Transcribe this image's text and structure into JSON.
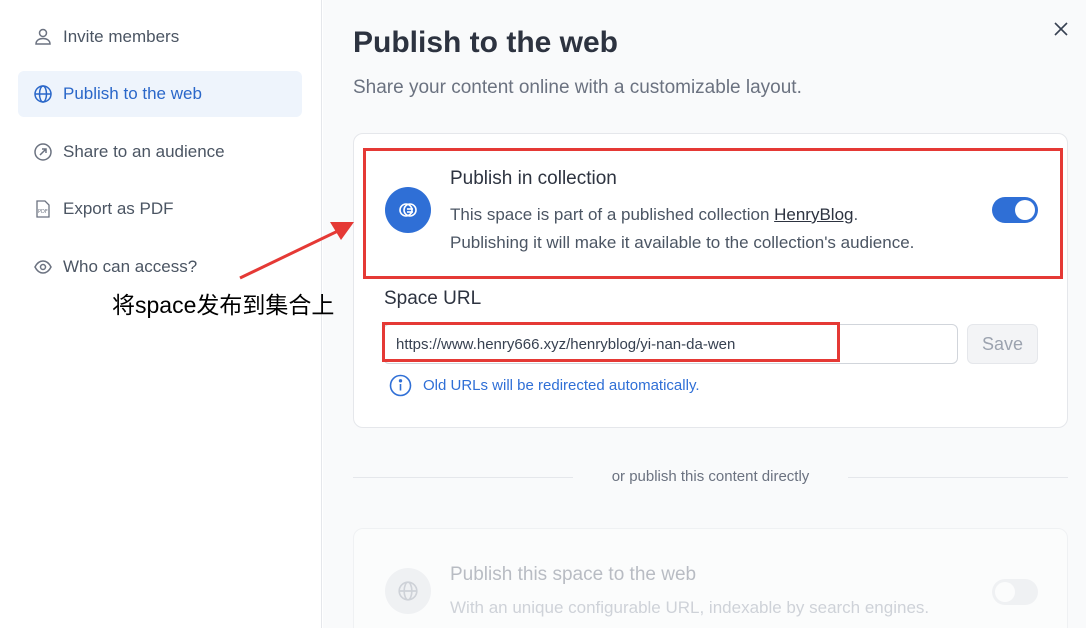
{
  "sidebar": {
    "items": [
      {
        "label": "Invite members",
        "icon": "users-icon"
      },
      {
        "label": "Publish to the web",
        "icon": "globe-icon",
        "active": true
      },
      {
        "label": "Share to an audience",
        "icon": "share-icon"
      },
      {
        "label": "Export as PDF",
        "icon": "pdf-icon"
      },
      {
        "label": "Who can access?",
        "icon": "eye-icon"
      }
    ]
  },
  "main": {
    "title": "Publish to the web",
    "subtitle": "Share your content online with a customizable layout.",
    "collection": {
      "heading": "Publish in collection",
      "desc_prefix": "This space is part of a published collection ",
      "collection_link": "HenryBlog",
      "desc_suffix": ".",
      "desc_line2": "Publishing it will make it available to the collection's audience.",
      "toggle_on": true
    },
    "space_url": {
      "label": "Space URL",
      "value": "https://www.henry666.xyz/henryblog/yi-nan-da-wen",
      "save_label": "Save",
      "hint": "Old URLs will be redirected automatically."
    },
    "divider_text": "or publish this content directly",
    "direct": {
      "heading": "Publish this space to the web",
      "desc": "With an unique configurable URL, indexable by search engines.",
      "toggle_on": false
    }
  },
  "annotation": {
    "text": "将space发布到集合上",
    "color": "#e53935"
  },
  "colors": {
    "accent": "#2f6fd6",
    "active_bg": "#eef4fc"
  }
}
